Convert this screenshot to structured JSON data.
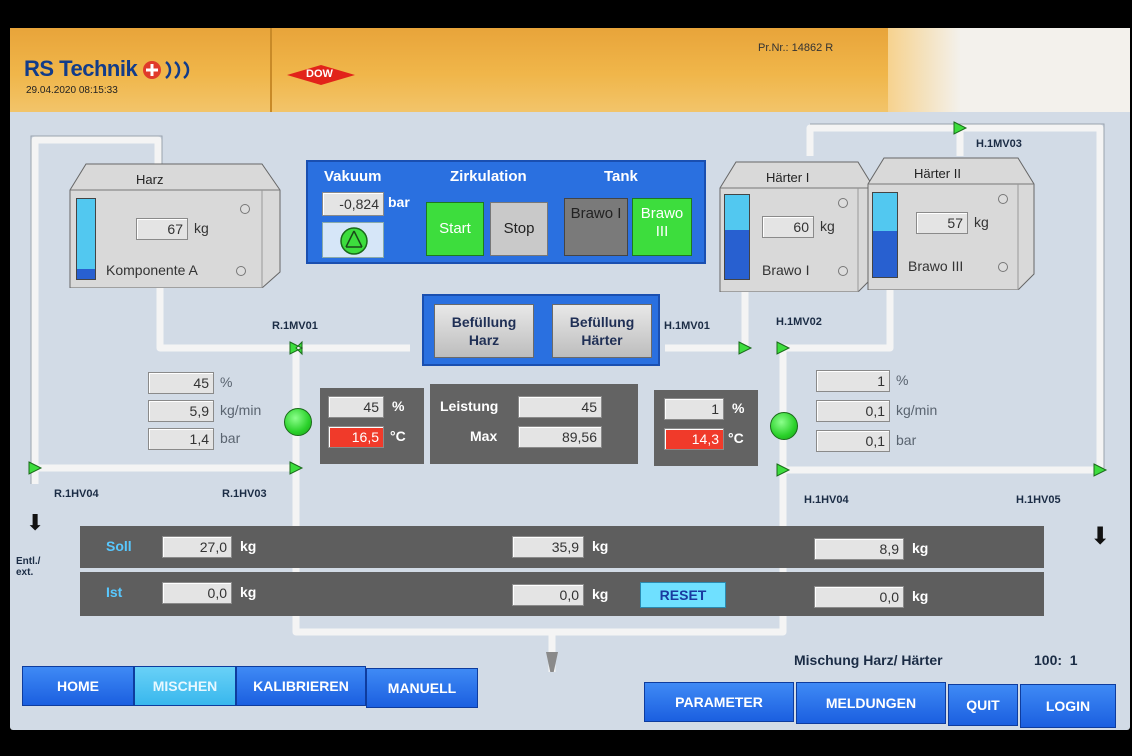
{
  "header": {
    "brand": "RS Technik",
    "datetime": "29.04.2020 08:15:33",
    "dow_logo": "DOW",
    "project_no": "Pr.Nr.: 14862 R"
  },
  "tanks": {
    "harz": {
      "title": "Harz",
      "value": "67",
      "unit": "kg",
      "component": "Komponente A",
      "level": 0.12
    },
    "haerter1": {
      "title": "Härter I",
      "value": "60",
      "unit": "kg",
      "component": "Brawo I",
      "level": 0.58
    },
    "haerter2": {
      "title": "Härter II",
      "value": "57",
      "unit": "kg",
      "component": "Brawo III",
      "level": 0.55
    }
  },
  "control_panel": {
    "vakuum_label": "Vakuum",
    "vakuum_value": "-0,824",
    "vakuum_unit": "bar",
    "zirkulation_label": "Zirkulation",
    "start_label": "Start",
    "stop_label": "Stop",
    "tank_label": "Tank",
    "brawo1_label": "Brawo I",
    "brawo3_label": "Brawo III"
  },
  "fill_buttons": {
    "harz_line1": "Befüllung",
    "harz_line2": "Harz",
    "haerter_line1": "Befüllung",
    "haerter_line2": "Härter"
  },
  "valves": {
    "r1mv01": "R.1MV01",
    "r1hv04": "R.1HV04",
    "r1hv03": "R.1HV03",
    "h1mv01": "H.1MV01",
    "h1mv02": "H.1MV02",
    "h1mv03": "H.1MV03",
    "h1hv04": "H.1HV04",
    "h1hv05": "H.1HV05"
  },
  "left_readings": {
    "percent": "45",
    "percent_unit": "%",
    "flow": "5,9",
    "flow_unit": "kg/min",
    "pressure": "1,4",
    "pressure_unit": "bar",
    "pump_percent": "45",
    "pump_percent_unit": "%",
    "temp": "16,5",
    "temp_unit": "°C"
  },
  "right_readings": {
    "percent": "1",
    "percent_unit": "%",
    "flow": "0,1",
    "flow_unit": "kg/min",
    "pressure": "0,1",
    "pressure_unit": "bar",
    "pump_percent": "1",
    "pump_percent_unit": "%",
    "temp": "14,3",
    "temp_unit": "°C"
  },
  "center": {
    "leistung_label": "Leistung",
    "leistung_value": "45",
    "max_label": "Max",
    "max_value": "89,56"
  },
  "summary": {
    "soll_label": "Soll",
    "ist_label": "Ist",
    "soll_left": "27,0",
    "soll_mid": "35,9",
    "soll_right": "8,9",
    "ist_left": "0,0",
    "ist_mid": "0,0",
    "ist_right": "0,0",
    "unit": "kg",
    "reset_label": "RESET",
    "entl_label": "Entl./\next."
  },
  "mix_ratio": {
    "label": "Mischung Harz/ Härter",
    "value": "100:  1"
  },
  "nav": {
    "home": "HOME",
    "mischen": "MISCHEN",
    "kalibrieren": "KALIBRIEREN",
    "manuell": "MANUELL",
    "parameter": "PARAMETER",
    "meldungen": "MELDUNGEN",
    "quit": "QUIT",
    "login": "LOGIN"
  },
  "colors": {
    "header": "#f0b64a",
    "panel_bg": "#d2dbe6",
    "nav_blue": "#1b5fe0",
    "nav_active": "#38b7ed",
    "pump_green": "#2ad12a",
    "temp_red": "#f03a2a",
    "liquid": "#52c8f0"
  }
}
